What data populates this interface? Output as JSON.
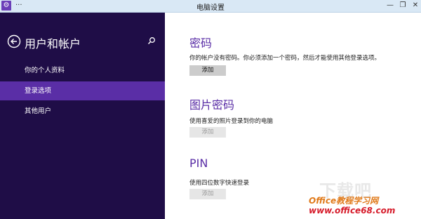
{
  "window": {
    "title": "电脑设置",
    "app_icon": "gear-icon",
    "menu_glyph": "···",
    "minimize": "—",
    "restore": "❐",
    "close": "✕"
  },
  "sidebar": {
    "title": "用户和帐户",
    "back_icon": "back-arrow-circle-icon",
    "search_icon": "search-icon",
    "items": [
      {
        "label": "你的个人资料",
        "active": false
      },
      {
        "label": "登录选项",
        "active": true
      },
      {
        "label": "其他用户",
        "active": false
      }
    ],
    "bg_color": "#1f0d47",
    "active_color": "#5a2ea6"
  },
  "main": {
    "sections": [
      {
        "heading": "密码",
        "description": "你的帐户没有密码。你必须添加一个密码，然后才能使用其他登录选项。",
        "button": "添加",
        "button_enabled": true
      },
      {
        "heading": "图片密码",
        "description": "使用喜爱的照片登录到你的电脑",
        "button": "添加",
        "button_enabled": false
      },
      {
        "heading": "PIN",
        "description": "使用四位数字快速登录",
        "button": "添加",
        "button_enabled": false
      }
    ],
    "heading_color": "#5a2ea6"
  },
  "watermark": {
    "line1": "下载吧",
    "line2": "Office教程学习网",
    "line3": "www.office68.com"
  }
}
